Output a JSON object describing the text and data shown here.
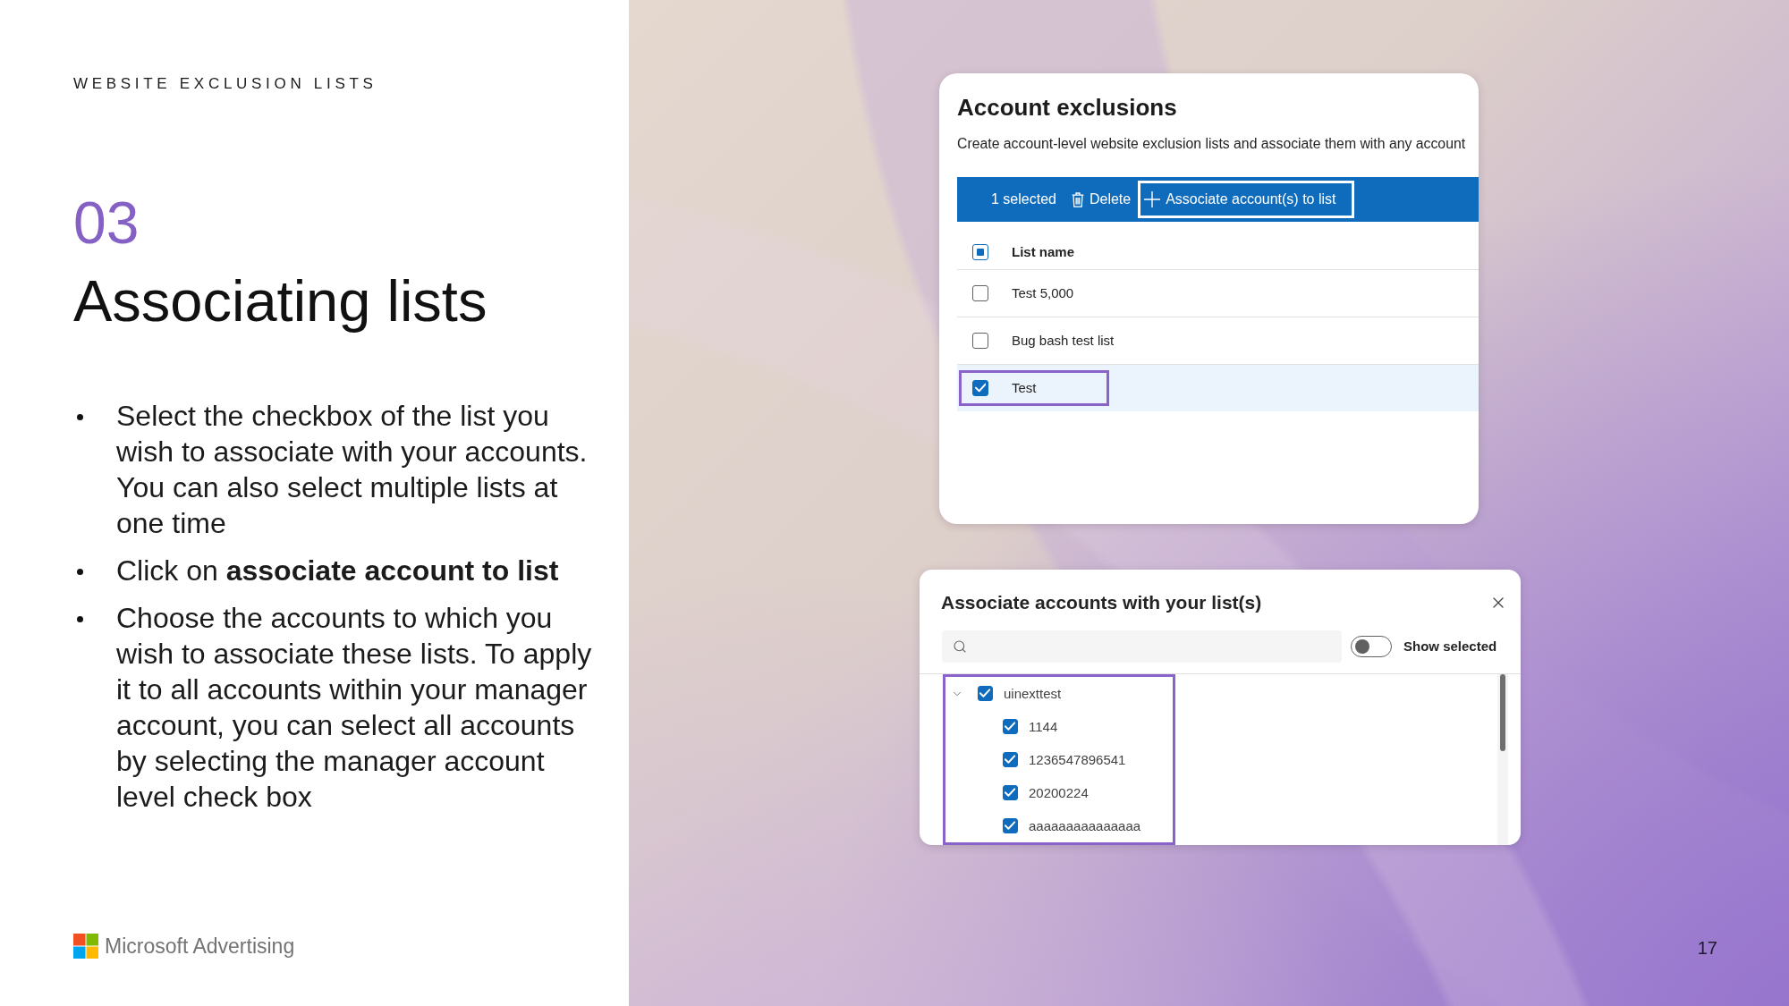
{
  "slide": {
    "section_label": "WEBSITE EXCLUSION LISTS",
    "number": "03",
    "title": "Associating lists",
    "bullets": [
      "Select the checkbox of the list you wish to associate with your accounts. You can also select multiple lists at one time",
      "Click on **associate account to list**",
      "Choose the accounts to which you wish to associate these lists. To apply it to all accounts within your manager account, you can select all accounts by selecting the manager account level check box"
    ],
    "logo_text": "Microsoft Advertising",
    "page_number": "17"
  },
  "account_exclusions": {
    "title": "Account exclusions",
    "description": "Create account-level website exclusion lists and associate them with any account",
    "command_bar": {
      "selection_count": "1 selected",
      "delete_label": "Delete",
      "associate_label": "Associate account(s) to list",
      "associate_focused": true
    },
    "table": {
      "header": {
        "label": "List name",
        "indeterminate": true
      },
      "rows": [
        {
          "name": "Test 5,000",
          "checked": false,
          "selected": false,
          "outlined": false
        },
        {
          "name": "Bug bash test list",
          "checked": false,
          "selected": false,
          "outlined": false
        },
        {
          "name": "Test",
          "checked": true,
          "selected": true,
          "outlined": true
        }
      ]
    }
  },
  "associate_dialog": {
    "title": "Associate accounts with your list(s)",
    "show_selected": {
      "label": "Show selected",
      "on": false
    },
    "tree": {
      "outlined": true,
      "items": [
        {
          "name": "uinexttest",
          "checked": true,
          "expanded": true,
          "children": [
            {
              "name": "1144",
              "checked": true
            },
            {
              "name": "1236547896541",
              "checked": true
            },
            {
              "name": "20200224",
              "checked": true
            },
            {
              "name": "aaaaaaaaaaaaaaa",
              "checked": true
            }
          ]
        }
      ]
    }
  }
}
